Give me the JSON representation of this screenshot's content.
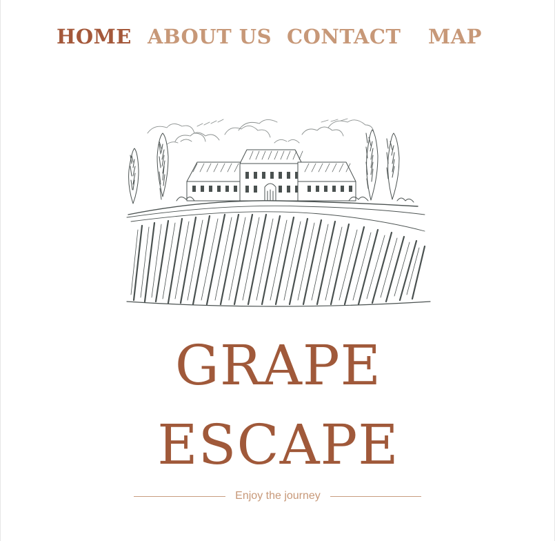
{
  "nav": {
    "items": [
      {
        "label": "HOME",
        "active": true
      },
      {
        "label": "ABOUT US",
        "active": false
      },
      {
        "label": "CONTACT",
        "active": false
      },
      {
        "label": "MAP",
        "active": false
      }
    ]
  },
  "hero": {
    "illustration": "vineyard-estate-sketch"
  },
  "brand": {
    "line1": "GRAPE",
    "line2": "ESCAPE",
    "tagline": "Enjoy the journey"
  },
  "colors": {
    "accent": "#a0593a",
    "muted_accent": "#c79878",
    "sketch": "#4a5150"
  }
}
